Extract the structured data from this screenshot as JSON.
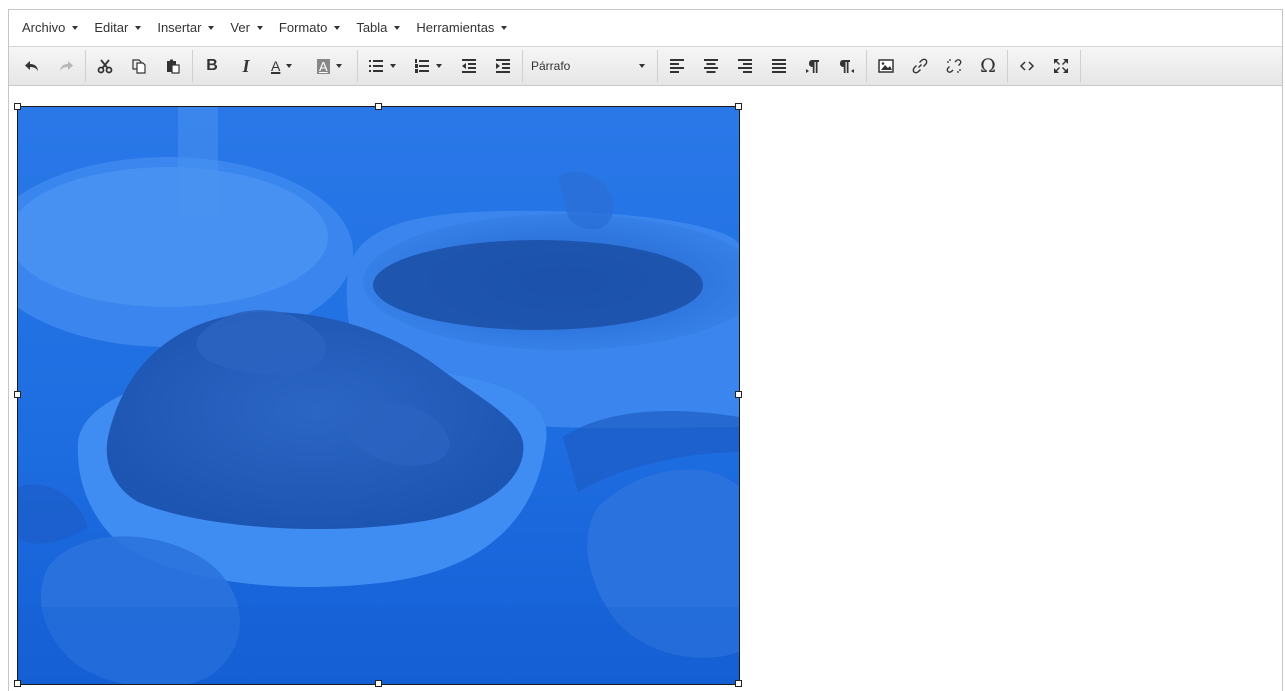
{
  "menubar": {
    "items": [
      {
        "label": "Archivo"
      },
      {
        "label": "Editar"
      },
      {
        "label": "Insertar"
      },
      {
        "label": "Ver"
      },
      {
        "label": "Formato"
      },
      {
        "label": "Tabla"
      },
      {
        "label": "Herramientas"
      }
    ]
  },
  "toolbar": {
    "format_select": "Párrafo",
    "icons": {
      "undo": "undo-icon",
      "redo": "redo-icon",
      "cut": "cut-icon",
      "copy": "copy-icon",
      "paste": "paste-icon",
      "bold": "B",
      "italic": "I",
      "text_color": "A",
      "bg_color": "A",
      "bullet_list": "bullet-list-icon",
      "numbered_list": "numbered-list-icon",
      "outdent": "outdent-icon",
      "indent": "indent-icon",
      "align_left": "align-left-icon",
      "align_center": "align-center-icon",
      "align_right": "align-right-icon",
      "align_justify": "align-justify-icon",
      "ltr": "ltr-icon",
      "rtl": "rtl-icon",
      "image": "image-icon",
      "link": "link-icon",
      "unlink": "unlink-icon",
      "omega": "Ω",
      "source_code": "source-code-icon",
      "fullscreen": "fullscreen-icon"
    }
  },
  "colors": {
    "image_tint": "#1668e6",
    "toolbar_bg": "#ececec",
    "text": "#333333"
  }
}
